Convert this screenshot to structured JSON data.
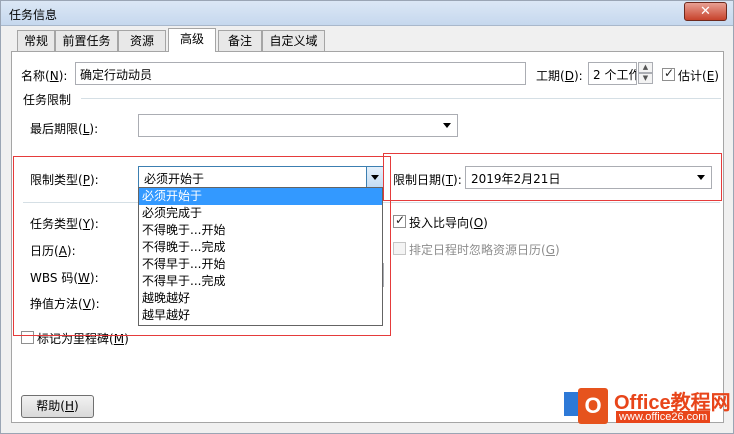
{
  "window": {
    "title": "任务信息",
    "close_glyph": "✕"
  },
  "tabs": [
    "常规",
    "前置任务",
    "资源",
    "高级",
    "备注",
    "自定义域"
  ],
  "active_tab": "高级",
  "name_label": {
    "text": "名称",
    "key": "N"
  },
  "name_value": "确定行动动员",
  "duration_label": {
    "text": "工期",
    "key": "D"
  },
  "duration_value": "2 个工作",
  "estimated_label": {
    "text": "估计",
    "key": "E"
  },
  "constraint_group": "任务限制",
  "deadline_label": {
    "text": "最后期限",
    "key": "L"
  },
  "deadline_value": "",
  "constraint_type_label": {
    "text": "限制类型",
    "key": "P"
  },
  "constraint_type_value": "必须开始于",
  "constraint_date_label": {
    "text": "限制日期",
    "key": "T"
  },
  "constraint_date_value": "2019年2月21日",
  "constraint_options": [
    "必须开始于",
    "必须完成于",
    "不得晚于...开始",
    "不得晚于...完成",
    "不得早于...开始",
    "不得早于...完成",
    "越晚越好",
    "越早越好"
  ],
  "task_type_label": {
    "text": "任务类型",
    "key": "Y"
  },
  "effort_driven_label": {
    "text": "投入比导向",
    "key": "O"
  },
  "calendar_label": {
    "text": "日历",
    "key": "A"
  },
  "ignore_calendar_label": {
    "text": "排定日程时忽略资源日历",
    "key": "G"
  },
  "wbs_label": {
    "text": "WBS 码",
    "key": "W"
  },
  "earned_value_label": {
    "text": "挣值方法",
    "key": "V"
  },
  "milestone_label": {
    "text": "标记为里程碑",
    "key": "M"
  },
  "help_button": {
    "text": "帮助",
    "key": "H"
  },
  "watermark": {
    "logo_letter": "O",
    "title": "Office教程网",
    "url": "www.office26.com"
  }
}
